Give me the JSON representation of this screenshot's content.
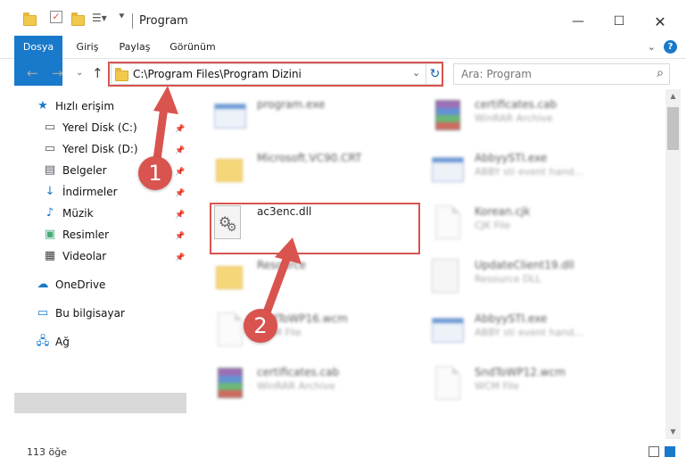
{
  "window": {
    "title": "Program"
  },
  "ribbon": {
    "tabs": [
      "Dosya",
      "Giriş",
      "Paylaş",
      "Görünüm"
    ]
  },
  "address": {
    "path": "C:\\Program Files\\Program Dizini"
  },
  "search": {
    "placeholder": "Ara: Program"
  },
  "sidebar": {
    "quick_access": "Hızlı erişim",
    "items": [
      {
        "label": "Yerel Disk (C:)"
      },
      {
        "label": "Yerel Disk (D:)"
      },
      {
        "label": "Belgeler"
      },
      {
        "label": "İndirmeler"
      },
      {
        "label": "Müzik"
      },
      {
        "label": "Resimler"
      },
      {
        "label": "Videolar"
      }
    ],
    "onedrive": "OneDrive",
    "this_pc": "Bu bilgisayar",
    "network": "Ağ"
  },
  "files": [
    {
      "name": "program.exe",
      "desc": ""
    },
    {
      "name": "certificates.cab",
      "desc": "WinRAR Archive"
    },
    {
      "name": "Microsoft.VC90.CRT",
      "desc": ""
    },
    {
      "name": "AbbyySTI.exe",
      "desc": "ABBY sti event hand..."
    },
    {
      "name": "ac3enc.dll",
      "desc": ""
    },
    {
      "name": "Korean.cjk",
      "desc": "CJK File"
    },
    {
      "name": "Resource",
      "desc": ""
    },
    {
      "name": "UpdateClient19.dll",
      "desc": "Resource DLL"
    },
    {
      "name": "SndToWP16.wcm",
      "desc": "WCM File"
    },
    {
      "name": "AbbyySTI.exe",
      "desc": "ABBY sti event hand..."
    },
    {
      "name": "certificates.cab",
      "desc": "WinRAR Archive"
    },
    {
      "name": "SndToWP12.wcm",
      "desc": "WCM File"
    }
  ],
  "badges": {
    "one": "1",
    "two": "2"
  },
  "status": {
    "count": "113 öğe"
  },
  "colors": {
    "accent": "#1979ca",
    "highlight": "#d9534f"
  }
}
